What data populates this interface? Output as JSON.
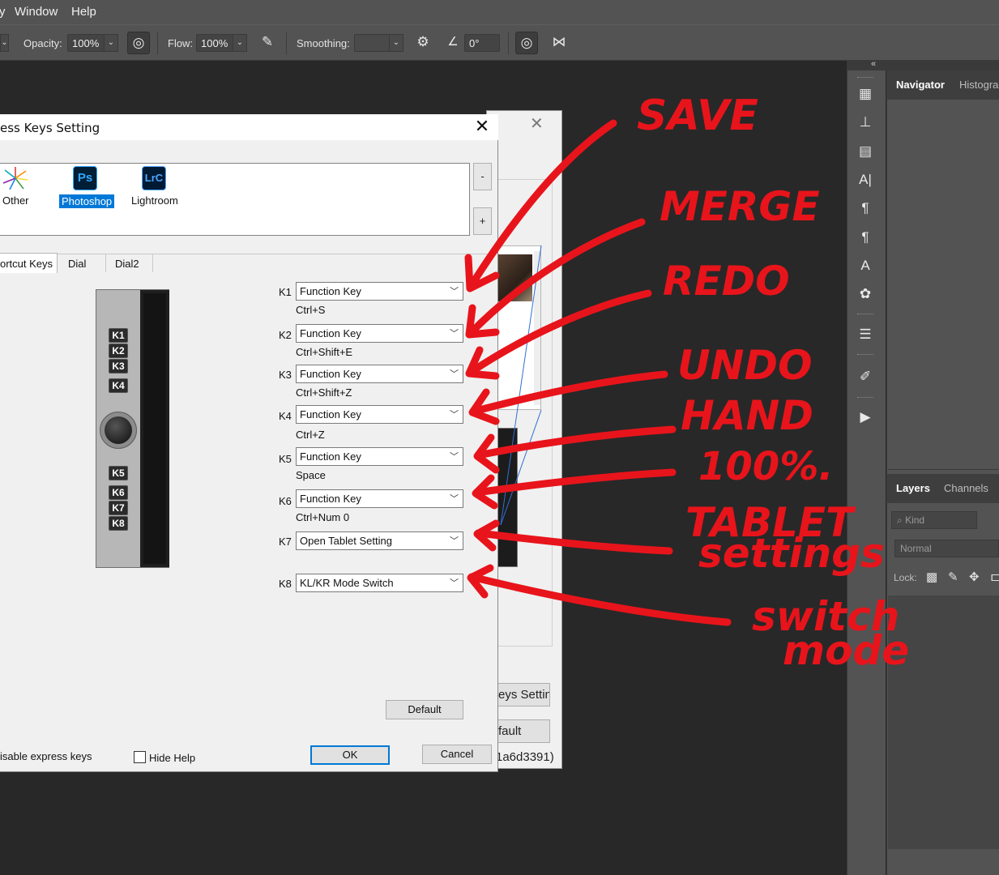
{
  "menubar": {
    "items": [
      "y",
      "Window",
      "Help"
    ]
  },
  "options_bar": {
    "opacity_label": "Opacity:",
    "opacity_value": "100%",
    "flow_label": "Flow:",
    "flow_value": "100%",
    "smoothing_label": "Smoothing:",
    "smoothing_value": "",
    "angle_value": "0°"
  },
  "panels": {
    "collapse_arrow": "«",
    "top_tabs": [
      "Navigator",
      "Histogra"
    ],
    "bottom_tabs": [
      "Layers",
      "Channels"
    ],
    "kind_placeholder": "Kind",
    "blend_mode": "Normal",
    "lock_label": "Lock:"
  },
  "back_dialog": {
    "keys_setting_button": "eys Settin",
    "default_button": "fault",
    "device_id": "1a6d3391)"
  },
  "dialog": {
    "title": "ess Keys Setting",
    "apps": [
      {
        "label": "Other",
        "icon": "starburst-icon"
      },
      {
        "label": "Photoshop",
        "icon_text": "Ps"
      },
      {
        "label": "Lightroom",
        "icon_text": "LrC"
      }
    ],
    "remove_button": "-",
    "add_button": "+",
    "tabs": [
      "ortcut Keys",
      "Dial",
      "Dial2"
    ],
    "device_keys": [
      "K1",
      "K2",
      "K3",
      "K4",
      "K5",
      "K6",
      "K7",
      "K8"
    ],
    "keys": [
      {
        "id": "K1",
        "action": "Function Key",
        "shortcut": "Ctrl+S"
      },
      {
        "id": "K2",
        "action": "Function Key",
        "shortcut": "Ctrl+Shift+E"
      },
      {
        "id": "K3",
        "action": "Function Key",
        "shortcut": "Ctrl+Shift+Z"
      },
      {
        "id": "K4",
        "action": "Function Key",
        "shortcut": "Ctrl+Z"
      },
      {
        "id": "K5",
        "action": "Function Key",
        "shortcut": "Space"
      },
      {
        "id": "K6",
        "action": "Function Key",
        "shortcut": "Ctrl+Num 0"
      },
      {
        "id": "K7",
        "action": "Open Tablet Setting",
        "shortcut": ""
      },
      {
        "id": "K8",
        "action": "KL/KR Mode Switch",
        "shortcut": ""
      }
    ],
    "default_button": "Default",
    "disable_label": "isable express keys",
    "hide_help_label": "Hide Help",
    "ok_button": "OK",
    "cancel_button": "Cancel"
  },
  "annotations": {
    "color": "#e8141b",
    "notes": [
      "SAVE",
      "MERGE",
      "REDO",
      "UNDO",
      "HAND",
      "100%.",
      "TABLET",
      "settings",
      "switch",
      "mode"
    ]
  }
}
